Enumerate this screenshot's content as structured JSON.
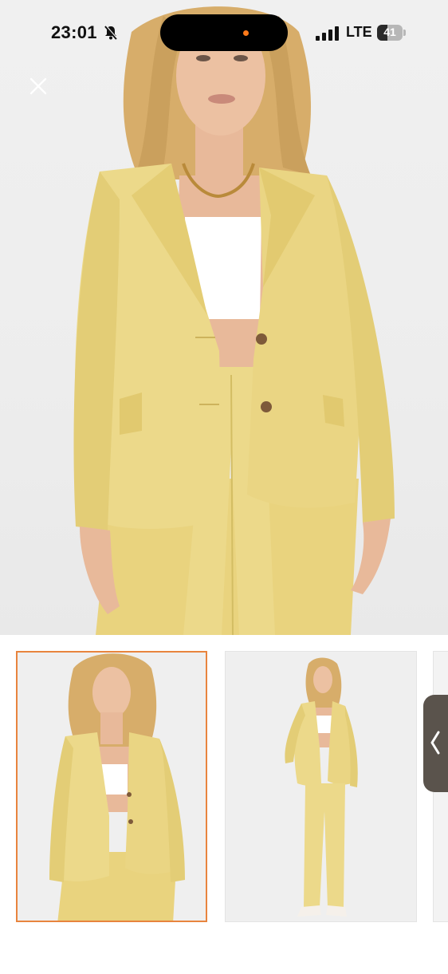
{
  "status_bar": {
    "time": "23:01",
    "mute_icon": "bell-slash-icon",
    "network": "LTE",
    "battery_level": "41",
    "battery_fraction": 0.41,
    "island_dot_color": "#ff7a1a"
  },
  "close_button": {
    "icon": "close-icon"
  },
  "gallery": {
    "selected_index": 0,
    "selected_border_color": "#e8843e",
    "thumbnails": [
      {
        "view": "upper-body",
        "selected": true
      },
      {
        "view": "full-body",
        "selected": false
      },
      {
        "view": "partial",
        "selected": false
      }
    ]
  },
  "side_handle": {
    "icon": "chevron-left-icon"
  },
  "colors": {
    "blazer": "#ecd98a",
    "blazer_shadow": "#d9c56f",
    "top": "#ffffff",
    "hair": "#d7ad6a",
    "skin": "#e8b99a",
    "background": "#ededed"
  }
}
